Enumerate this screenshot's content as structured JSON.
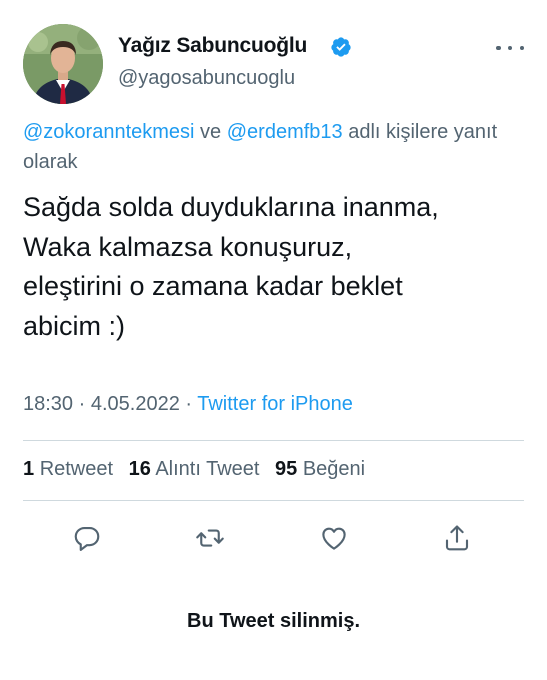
{
  "author": {
    "name": "Yağız Sabuncuoğlu",
    "handle": "@yagosabuncuoglu",
    "verified": true,
    "avatar_icon": "profile-photo"
  },
  "reply_context": {
    "mention_1": "@zokoranntekmesi",
    "joiner": " ve ",
    "mention_2": "@erdemfb13",
    "suffix": " adlı kişilere yanıt olarak"
  },
  "tweet": {
    "lines": [
      "Sağda solda duyduklarına inanma,",
      "Waka kalmazsa konuşuruz,",
      "eleştirini o zamana kadar beklet",
      "abicim :)"
    ],
    "time": "18:30",
    "date": "4.05.2022",
    "separator": " · ",
    "source": "Twitter for iPhone"
  },
  "stats": {
    "retweets_count": "1",
    "retweets_label": "Retweet",
    "quotes_count": "16",
    "quotes_label": "Alıntı Tweet",
    "likes_count": "95",
    "likes_label": "Beğeni"
  },
  "actions": {
    "reply_icon": "reply-icon",
    "retweet_icon": "retweet-icon",
    "like_icon": "heart-icon",
    "share_icon": "share-icon"
  },
  "footer": {
    "deleted_notice": "Bu Tweet silinmiş."
  },
  "colors": {
    "accent": "#1d9bf0",
    "text_primary": "#0f1419",
    "text_secondary": "#536471",
    "divider": "#cfd9de"
  }
}
